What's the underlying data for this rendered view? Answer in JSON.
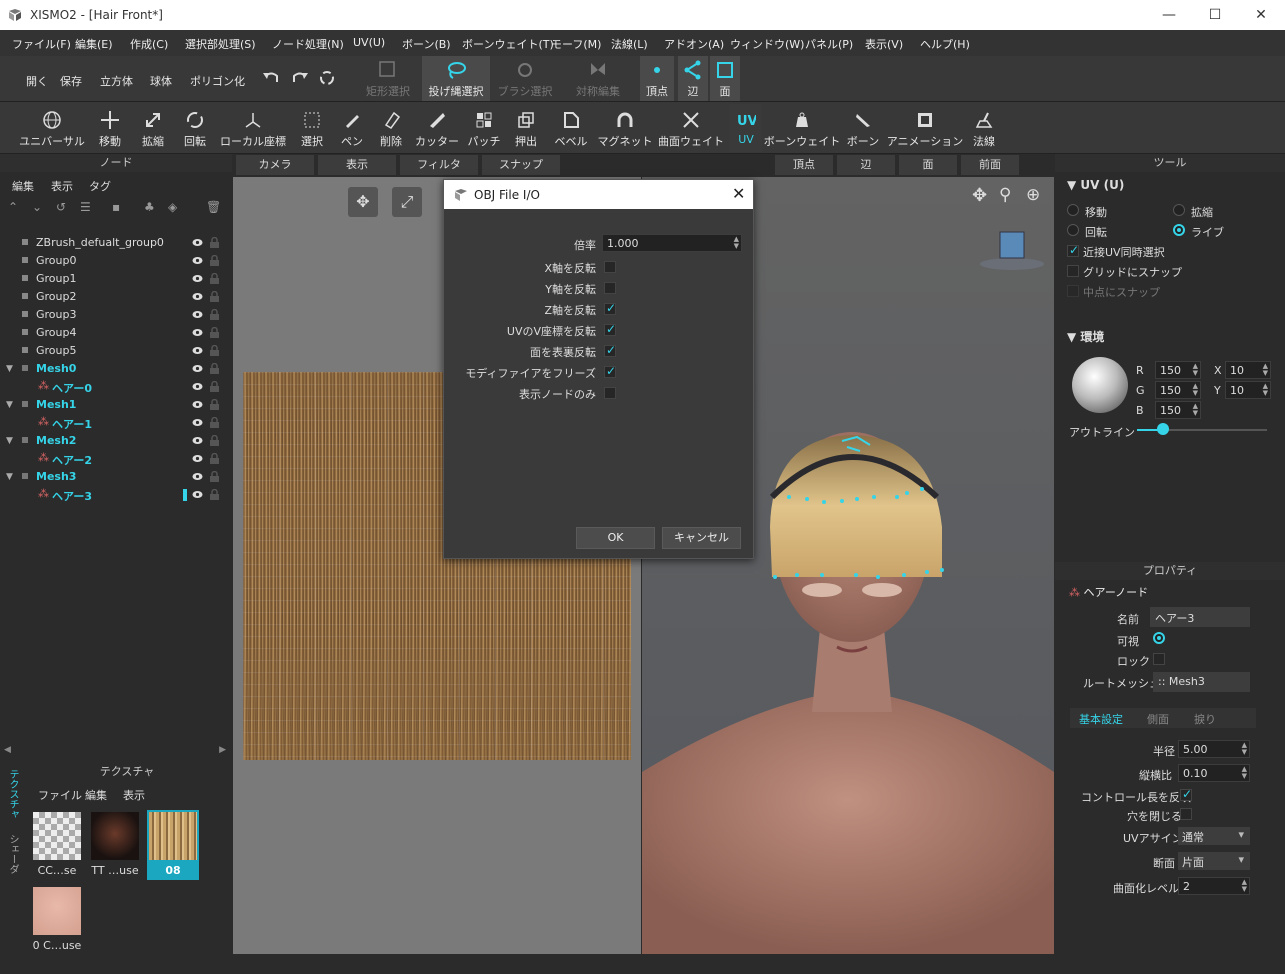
{
  "window": {
    "title": "XISMO2 - [Hair Front*]"
  },
  "menu": [
    "ファイル(F)",
    "編集(E)",
    "作成(C)",
    "選択部処理(S)",
    "ノード処理(N)",
    "UV(U)",
    "ボーン(B)",
    "ボーンウェイト(T)",
    "モーフ(M)",
    "法線(L)",
    "アドオン(A)",
    "ウィンドウ(W)",
    "パネル(P)",
    "表示(V)",
    "ヘルプ(H)"
  ],
  "toolbar1": {
    "open": "開く",
    "save": "保存",
    "cube": "立方体",
    "sphere": "球体",
    "polygonize": "ポリゴン化",
    "rect_select": "矩形選択",
    "lasso_select": "投げ縄選択",
    "brush_select": "ブラシ選択",
    "sym_edit": "対称編集",
    "vertex": "頂点",
    "edge": "辺",
    "face": "面"
  },
  "toolbar2": [
    "ユニバーサル",
    "移動",
    "拡縮",
    "回転",
    "ローカル座標",
    "選択",
    "ペン",
    "削除",
    "カッター",
    "パッチ",
    "押出",
    "ベベル",
    "マグネット",
    "曲面ウェイト",
    "UV",
    "ボーンウェイト",
    "ボーン",
    "アニメーション",
    "法線"
  ],
  "node_panel": {
    "title": "ノード",
    "menu": [
      "編集",
      "表示",
      "タグ"
    ],
    "nodes": [
      {
        "label": "ZBrush_defualt_group0",
        "type": "group"
      },
      {
        "label": "Group0",
        "type": "group"
      },
      {
        "label": "Group1",
        "type": "group"
      },
      {
        "label": "Group2",
        "type": "group"
      },
      {
        "label": "Group3",
        "type": "group"
      },
      {
        "label": "Group4",
        "type": "group"
      },
      {
        "label": "Group5",
        "type": "group"
      },
      {
        "label": "Mesh0",
        "type": "mesh"
      },
      {
        "label": "ヘアー0",
        "type": "hair"
      },
      {
        "label": "Mesh1",
        "type": "mesh"
      },
      {
        "label": "ヘアー1",
        "type": "hair"
      },
      {
        "label": "Mesh2",
        "type": "mesh"
      },
      {
        "label": "ヘアー2",
        "type": "hair"
      },
      {
        "label": "Mesh3",
        "type": "mesh"
      },
      {
        "label": "ヘアー3",
        "type": "hair"
      }
    ]
  },
  "texture_panel": {
    "title": "テクスチャ",
    "menu": [
      "ファイル",
      "編集",
      "表示"
    ],
    "side_tabs": [
      "テクスチャ",
      "シェーダ"
    ],
    "thumbs": [
      "CC…se",
      "TT …use",
      "08",
      "0 C…use"
    ]
  },
  "view_headers": {
    "camera": "カメラ",
    "display": "表示",
    "filter": "フィルタ",
    "snap": "スナップ",
    "vertex": "頂点",
    "edge": "辺",
    "face": "面",
    "front": "前面"
  },
  "dialog": {
    "title": "OBJ File I/O",
    "scale_label": "倍率",
    "scale_value": "1.000",
    "options": [
      {
        "label": "X軸を反転",
        "checked": false
      },
      {
        "label": "Y軸を反転",
        "checked": false
      },
      {
        "label": "Z軸を反転",
        "checked": true
      },
      {
        "label": "UVのV座標を反転",
        "checked": true
      },
      {
        "label": "面を表裏反転",
        "checked": true
      },
      {
        "label": "モディファイアをフリーズ",
        "checked": true
      },
      {
        "label": "表示ノードのみ",
        "checked": false
      }
    ],
    "ok": "OK",
    "cancel": "キャンセル"
  },
  "tool_panel": {
    "title": "ツール",
    "section": "UV (U)",
    "move": "移動",
    "scale": "拡縮",
    "rotate": "回転",
    "live": "ライブ",
    "near_uv": "近接UV同時選択",
    "grid_snap": "グリッドにスナップ",
    "mid_snap": "中点にスナップ",
    "env": "環境",
    "r_label": "R",
    "r": "150",
    "g_label": "G",
    "g": "150",
    "b_label": "B",
    "b": "150",
    "x_label": "X",
    "x": "10",
    "y_label": "Y",
    "y": "10",
    "outline": "アウトライン",
    "outline_value": 0.2
  },
  "prop_panel": {
    "title": "プロパティ",
    "node_type": "ヘアーノード",
    "name_label": "名前",
    "name": "ヘアー3",
    "visible": "可視",
    "lock": "ロック",
    "root_mesh_label": "ルートメッシュ",
    "root_mesh": ":: Mesh3",
    "tabs": [
      "基本設定",
      "側面",
      "捩り"
    ],
    "radius_label": "半径",
    "radius": "5.00",
    "aspect_label": "縦横比",
    "aspect": "0.10",
    "reflect_ctrl": "コントロール長を反映",
    "close_hole": "穴を閉じる",
    "uv_assign_label": "UVアサイン",
    "uv_assign": "通常",
    "section_label": "断面",
    "section": "片面",
    "subdiv_label": "曲面化レベル",
    "subdiv": "2"
  },
  "colors": {
    "accent": "#35d4e8",
    "bg": "#2b2b2b",
    "toolbar": "#383838"
  }
}
